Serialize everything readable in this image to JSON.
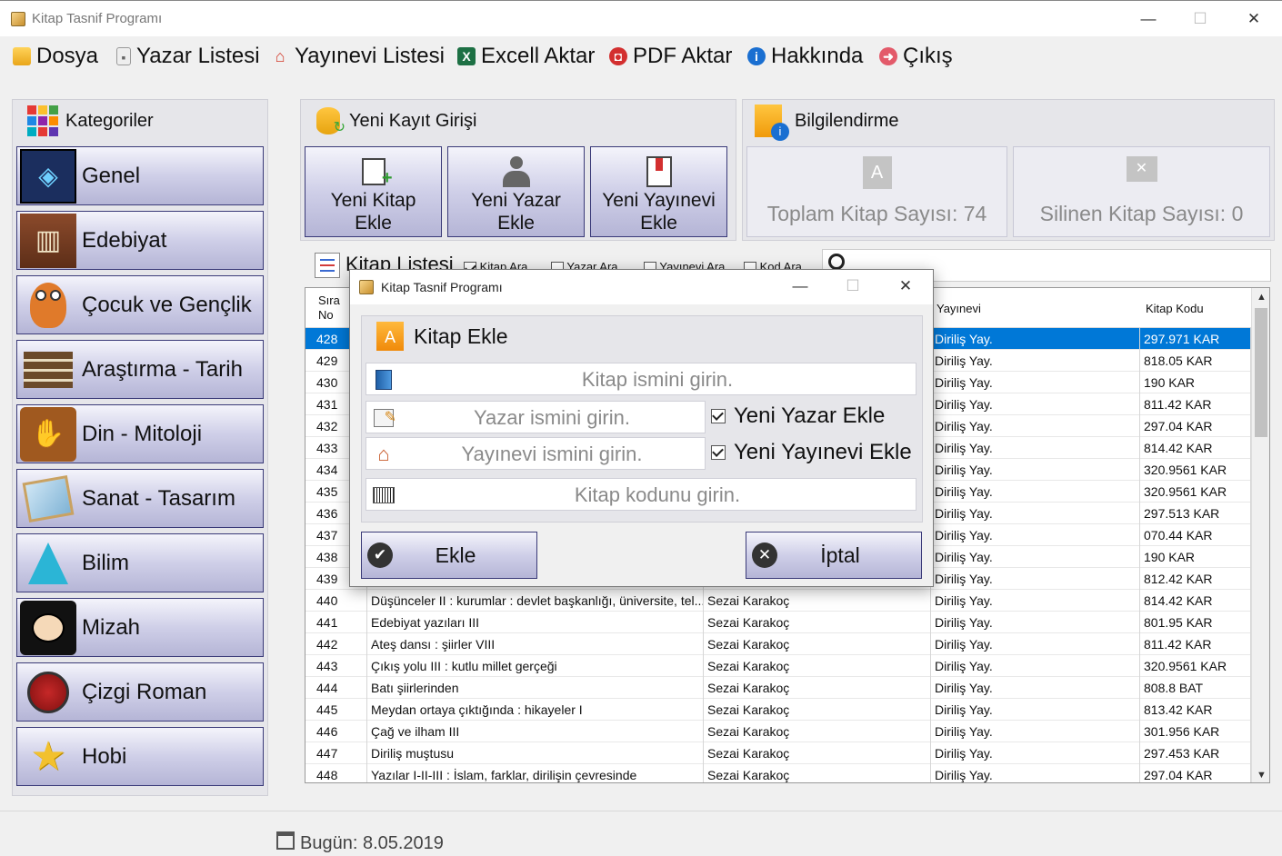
{
  "window": {
    "title": "Kitap Tasnif Programı",
    "min": "—",
    "max": "☐",
    "close": "✕"
  },
  "menu": [
    {
      "label": "Dosya",
      "icon": "folder-icon"
    },
    {
      "label": "Yazar Listesi",
      "icon": "user-icon"
    },
    {
      "label": "Yayınevi Listesi",
      "icon": "home-icon"
    },
    {
      "label": "Excell Aktar",
      "icon": "excel-icon"
    },
    {
      "label": "PDF Aktar",
      "icon": "pdf-icon"
    },
    {
      "label": "Hakkında",
      "icon": "info-icon"
    },
    {
      "label": "Çıkış",
      "icon": "exit-icon"
    }
  ],
  "categories": {
    "title": "Kategoriler",
    "items": [
      "Genel",
      "Edebiyat",
      "Çocuk ve Gençlik",
      "Araştırma - Tarih",
      "Din - Mitoloji",
      "Sanat - Tasarım",
      "Bilim",
      "Mizah",
      "Çizgi Roman",
      "Hobi"
    ]
  },
  "new_record": {
    "title": "Yeni Kayıt Girişi",
    "buttons": [
      {
        "line1": "Yeni Kitap",
        "line2": "Ekle"
      },
      {
        "line1": "Yeni Yazar",
        "line2": "Ekle"
      },
      {
        "line1": "Yeni Yayınevi",
        "line2": "Ekle"
      }
    ]
  },
  "info": {
    "title": "Bilgilendirme",
    "total": "Toplam Kitap Sayısı: 74",
    "deleted": "Silinen Kitap Sayısı: 0"
  },
  "book_list": {
    "title": "Kitap Listesi",
    "filters": [
      {
        "label": "Kitap Ara",
        "checked": true
      },
      {
        "label": "Yazar Ara",
        "checked": false
      },
      {
        "label": "Yayınevi Ara",
        "checked": false
      },
      {
        "label": "Kod Ara",
        "checked": false
      }
    ],
    "columns": {
      "sira1": "Sıra",
      "sira2": "No",
      "kitap": "",
      "yazar": "",
      "yayinevi": "Yayınevi",
      "kod": "Kitap Kodu"
    },
    "rows": [
      {
        "no": "428",
        "kitap": "",
        "yazar": "",
        "yayinevi": "Diriliş Yay.",
        "kod": "297.971 KAR"
      },
      {
        "no": "429",
        "kitap": "",
        "yazar": "",
        "yayinevi": "Diriliş Yay.",
        "kod": "818.05 KAR"
      },
      {
        "no": "430",
        "kitap": "",
        "yazar": "",
        "yayinevi": "Diriliş Yay.",
        "kod": "190 KAR"
      },
      {
        "no": "431",
        "kitap": "",
        "yazar": "",
        "yayinevi": "Diriliş Yay.",
        "kod": "811.42 KAR"
      },
      {
        "no": "432",
        "kitap": "",
        "yazar": "",
        "yayinevi": "Diriliş Yay.",
        "kod": "297.04 KAR"
      },
      {
        "no": "433",
        "kitap": "",
        "yazar": "",
        "yayinevi": "Diriliş Yay.",
        "kod": "814.42 KAR"
      },
      {
        "no": "434",
        "kitap": "",
        "yazar": "",
        "yayinevi": "Diriliş Yay.",
        "kod": "320.9561 KAR"
      },
      {
        "no": "435",
        "kitap": "",
        "yazar": "",
        "yayinevi": "Diriliş Yay.",
        "kod": "320.9561 KAR"
      },
      {
        "no": "436",
        "kitap": "",
        "yazar": "",
        "yayinevi": "Diriliş Yay.",
        "kod": "297.513 KAR"
      },
      {
        "no": "437",
        "kitap": "",
        "yazar": "",
        "yayinevi": "Diriliş Yay.",
        "kod": "070.44 KAR"
      },
      {
        "no": "438",
        "kitap": "",
        "yazar": "",
        "yayinevi": "Diriliş Yay.",
        "kod": "190 KAR"
      },
      {
        "no": "439",
        "kitap": "",
        "yazar": "",
        "yayinevi": "Diriliş Yay.",
        "kod": "812.42 KAR"
      },
      {
        "no": "440",
        "kitap": "Düşünceler II : kurumlar : devlet başkanlığı, üniversite, tel...",
        "yazar": "Sezai Karakoç",
        "yayinevi": "Diriliş Yay.",
        "kod": "814.42 KAR"
      },
      {
        "no": "441",
        "kitap": "Edebiyat yazıları III",
        "yazar": "Sezai Karakoç",
        "yayinevi": "Diriliş Yay.",
        "kod": "801.95 KAR"
      },
      {
        "no": "442",
        "kitap": "Ateş dansı : şiirler VIII",
        "yazar": "Sezai Karakoç",
        "yayinevi": "Diriliş Yay.",
        "kod": "811.42 KAR"
      },
      {
        "no": "443",
        "kitap": "Çıkış yolu III : kutlu millet gerçeği",
        "yazar": "Sezai Karakoç",
        "yayinevi": "Diriliş Yay.",
        "kod": "320.9561 KAR"
      },
      {
        "no": "444",
        "kitap": "Batı şiirlerinden",
        "yazar": "Sezai Karakoç",
        "yayinevi": "Diriliş Yay.",
        "kod": "808.8 BAT"
      },
      {
        "no": "445",
        "kitap": "Meydan ortaya çıktığında : hikayeler I",
        "yazar": "Sezai Karakoç",
        "yayinevi": "Diriliş Yay.",
        "kod": "813.42 KAR"
      },
      {
        "no": "446",
        "kitap": "Çağ ve ilham III",
        "yazar": "Sezai Karakoç",
        "yayinevi": "Diriliş Yay.",
        "kod": "301.956 KAR"
      },
      {
        "no": "447",
        "kitap": "Diriliş muştusu",
        "yazar": "Sezai Karakoç",
        "yayinevi": "Diriliş Yay.",
        "kod": "297.453 KAR"
      },
      {
        "no": "448",
        "kitap": "Yazılar I-II-III : İslam, farklar, dirilişin çevresinde",
        "yazar": "Sezai Karakoç",
        "yayinevi": "Diriliş Yay.",
        "kod": "297.04 KAR"
      }
    ]
  },
  "status": {
    "date": "Bugün: 8.05.2019"
  },
  "dialog": {
    "title": "Kitap Tasnif Programı",
    "heading": "Kitap Ekle",
    "book_placeholder": "Kitap ismini girin.",
    "author_placeholder": "Yazar ismini girin.",
    "publisher_placeholder": "Yayınevi ismini girin.",
    "code_placeholder": "Kitap kodunu girin.",
    "new_author": "Yeni Yazar Ekle",
    "new_publisher": "Yeni Yayınevi Ekle",
    "ok": "Ekle",
    "cancel": "İptal"
  }
}
